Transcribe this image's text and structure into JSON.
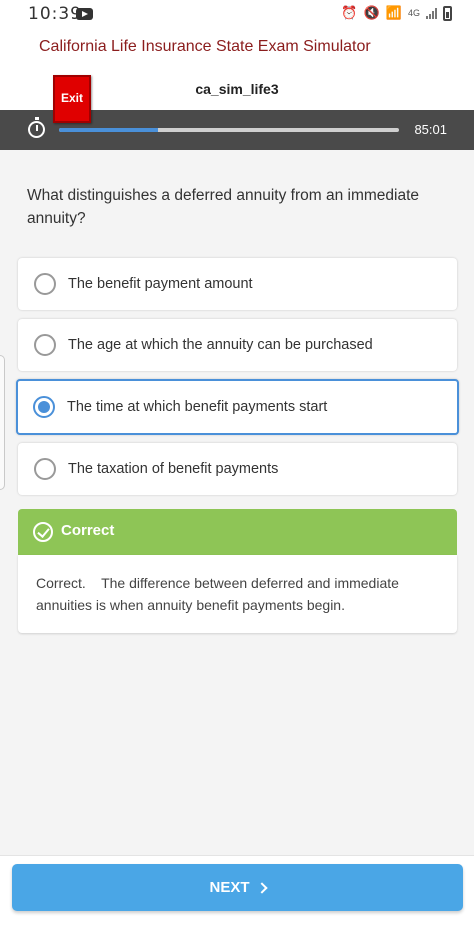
{
  "status_bar": {
    "time": "10:39",
    "network": "4G"
  },
  "header": {
    "app_title": "California Life Insurance State Exam Simulator",
    "exit_label": "Exit",
    "sim_name": "ca_sim_life3"
  },
  "progress": {
    "fraction": 0.29,
    "timer": "85:01"
  },
  "question": {
    "text": "What distinguishes a deferred annuity from an immediate annuity?",
    "options": [
      {
        "label": "The benefit payment amount",
        "selected": false
      },
      {
        "label": "The age at which the annuity can be purchased",
        "selected": false
      },
      {
        "label": "The time at which benefit payments start",
        "selected": true
      },
      {
        "label": "The taxation of benefit payments",
        "selected": false
      }
    ]
  },
  "result": {
    "title": "Correct",
    "explanation": "Correct.    The difference between deferred and immediate annuities is when annuity benefit payments begin."
  },
  "footer": {
    "next_label": "NEXT"
  },
  "colors": {
    "accent": "#4a90d9",
    "correct": "#8ec556",
    "exit": "#e00000",
    "title": "#8b1d1d"
  }
}
